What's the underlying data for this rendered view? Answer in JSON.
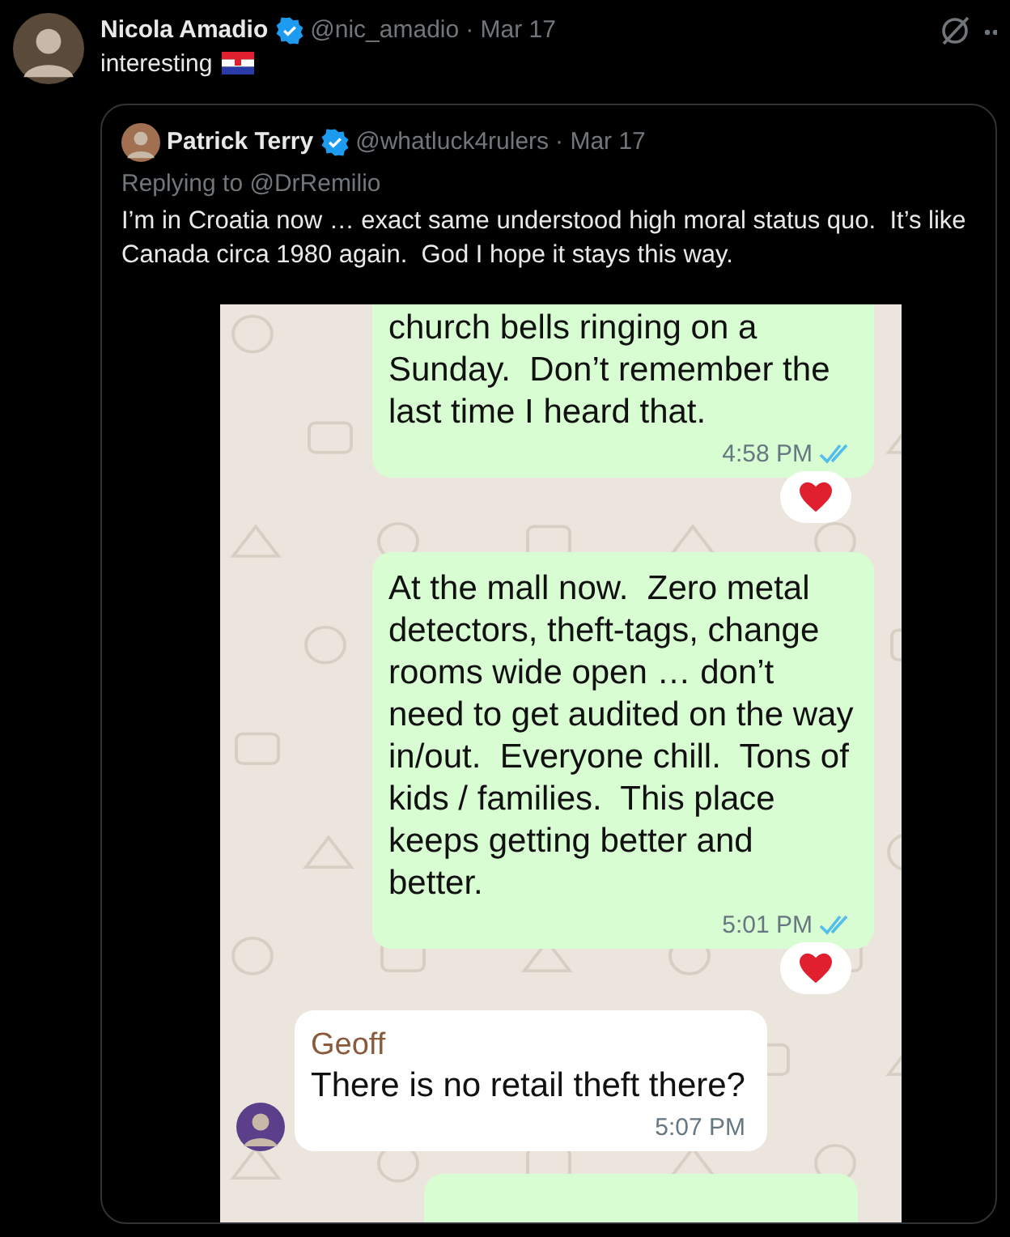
{
  "tweet": {
    "name": "Nicola Amadio",
    "handle": "@nic_amadio",
    "date": "· Mar 17",
    "text": "interesting"
  },
  "quote": {
    "name": "Patrick Terry",
    "handle": "@whatluck4rulers",
    "date": "· Mar 17",
    "replying": "Replying to @DrRemilio",
    "text": "I’m in Croatia now … exact same understood high moral status quo.  It’s like Canada circa 1980 again.  God I hope it stays this way."
  },
  "chat": {
    "messages": [
      {
        "kind": "outgoing",
        "text": "church bells ringing on a Sunday.  Don’t remember the last time I heard that.",
        "time": "4:58 PM",
        "read": true,
        "reaction": true,
        "cut_top": true
      },
      {
        "kind": "outgoing",
        "text": "At the mall now.  Zero metal detectors, theft-tags, change rooms wide open … don’t need to get audited on the way in/out.  Everyone chill.  Tons of kids / families.  This place keeps getting better and better.",
        "time": "5:01 PM",
        "read": true,
        "reaction": true,
        "cut_top": false
      },
      {
        "kind": "incoming",
        "sender": "Geoff",
        "text": "There is no retail theft there?",
        "time": "5:07 PM"
      },
      {
        "kind": "outgoing_stub"
      }
    ]
  }
}
